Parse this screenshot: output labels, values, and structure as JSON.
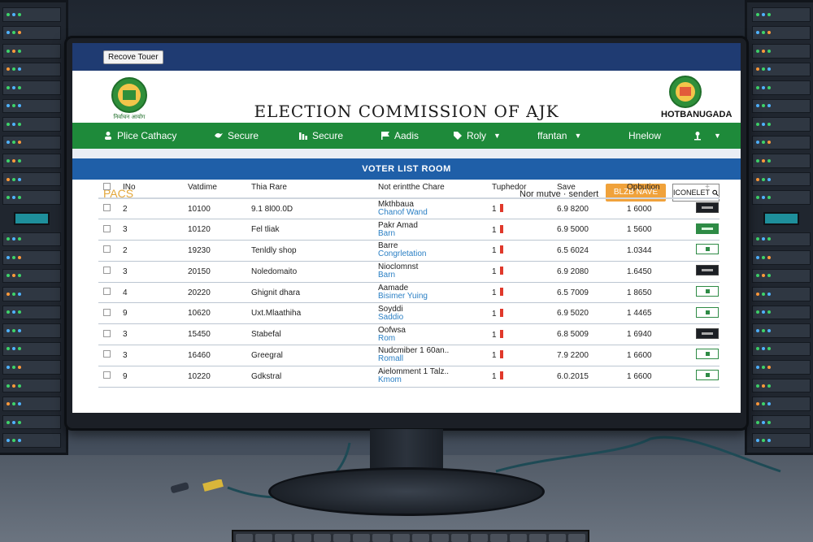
{
  "top_bar": {
    "remove_tour": "Recove Touer"
  },
  "header": {
    "title": "ELECTION COMMISSION OF AJK",
    "logo_left_caption": "निर्वाचन आयोग",
    "right_org": "HOTBANUGADA"
  },
  "nav": {
    "items": [
      {
        "label": "Plice Cathacy",
        "icon": "user-pen-icon",
        "chevron": false
      },
      {
        "label": "Secure",
        "icon": "bird-icon",
        "chevron": false
      },
      {
        "label": "Secure",
        "icon": "bar-chart-icon",
        "chevron": false
      },
      {
        "label": "Aadis",
        "icon": "flag-icon",
        "chevron": false
      },
      {
        "label": "Roly",
        "icon": "tag-icon",
        "chevron": true
      },
      {
        "label": "ffantan",
        "icon": "",
        "chevron": true
      },
      {
        "label": "Hnelow",
        "icon": "",
        "chevron": false
      },
      {
        "label": "",
        "icon": "user-icon",
        "chevron": true
      }
    ]
  },
  "band": {
    "title": "VOTER LIST ROOM"
  },
  "toolbar": {
    "section": "PACS",
    "text": "Nor mutve · sendert",
    "button": "BLZB NAVE",
    "search": "ICONELET"
  },
  "table": {
    "headers": [
      "INo",
      "Vatdime",
      "Thia Rare",
      "Not erintthe Chare",
      "Tuphedor",
      "Save",
      "Opbution",
      "+"
    ],
    "rows": [
      {
        "no": "2",
        "id": "10100",
        "name": "9.1 8l00.0D",
        "detail1": "Mkthbaua",
        "detail2": "Chanof Wand",
        "count": "1",
        "save": "6.9 8200",
        "opt": "1 6000",
        "action": "dark"
      },
      {
        "no": "3",
        "id": "10120",
        "name": "Fel tliak",
        "detail1": "Pakr Amad",
        "detail2": "Barn",
        "count": "1",
        "save": "6.9 5000",
        "opt": "1 5600",
        "action": "green"
      },
      {
        "no": "2",
        "id": "19230",
        "name": "Tenldly shop",
        "detail1": "Barre",
        "detail2": "Congrletation",
        "count": "1",
        "save": "6.5 6024",
        "opt": "1.0344",
        "action": "outline"
      },
      {
        "no": "3",
        "id": "20150",
        "name": "Noledomaito",
        "detail1": "Nioclomnst",
        "detail2": "Barn",
        "count": "1",
        "save": "6.9 2080",
        "opt": "1.6450",
        "action": "dark"
      },
      {
        "no": "4",
        "id": "20220",
        "name": "Ghignit dhara",
        "detail1": "Aamade",
        "detail2": "Bisimer Yuing",
        "count": "1",
        "save": "6.5 7009",
        "opt": "1 8650",
        "action": "outline"
      },
      {
        "no": "9",
        "id": "10620",
        "name": "Uxt.Mlaathiha",
        "detail1": "Soyddi",
        "detail2": "Saddio",
        "count": "1",
        "save": "6.9 5020",
        "opt": "1 4465",
        "action": "outline"
      },
      {
        "no": "3",
        "id": "15450",
        "name": "Stabefal",
        "detail1": "Oofwsa",
        "detail2": "Rom",
        "count": "1",
        "save": "6.8 5009",
        "opt": "1 6940",
        "action": "dark"
      },
      {
        "no": "3",
        "id": "16460",
        "name": "Greegral",
        "detail1": "Nudcmiber 1 60an..",
        "detail2": "Romall",
        "count": "1",
        "save": "7.9 2200",
        "opt": "1 6600",
        "action": "outline"
      },
      {
        "no": "9",
        "id": "10220",
        "name": "Gdkstral",
        "detail1": "Aielomment 1 Talz..",
        "detail2": "Kmom",
        "count": "1",
        "save": "6.0.2015",
        "opt": "1 6600",
        "action": "outline"
      }
    ]
  },
  "colors": {
    "top_bar": "#1f3b72",
    "nav": "#1e8a3a",
    "band": "#1f5fa8",
    "accent_orange": "#f0a23b",
    "flag_red": "#e0392b"
  }
}
